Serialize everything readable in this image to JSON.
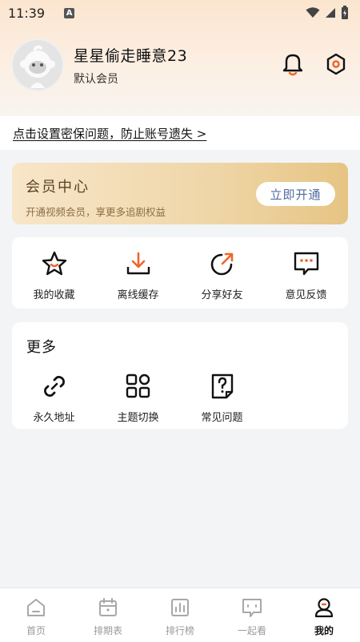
{
  "status_bar": {
    "time": "11:39",
    "indicator": "A"
  },
  "profile": {
    "username": "星星偷走睡意23",
    "member_status": "默认会员"
  },
  "security": {
    "prompt": "点击设置密保问题，防止账号遗失 >"
  },
  "vip": {
    "title": "会员中心",
    "subtitle": "开通视频会员，享更多追剧权益",
    "button": "立即开通"
  },
  "quick_actions": [
    {
      "label": "我的收藏",
      "icon": "star-icon"
    },
    {
      "label": "离线缓存",
      "icon": "download-icon"
    },
    {
      "label": "分享好友",
      "icon": "share-icon"
    },
    {
      "label": "意见反馈",
      "icon": "feedback-icon"
    }
  ],
  "more": {
    "title": "更多",
    "items": [
      {
        "label": "永久地址",
        "icon": "link-icon"
      },
      {
        "label": "主题切换",
        "icon": "theme-grid-icon"
      },
      {
        "label": "常见问题",
        "icon": "faq-icon"
      }
    ]
  },
  "tabs": [
    {
      "label": "首页",
      "icon": "home-icon"
    },
    {
      "label": "排期表",
      "icon": "calendar-icon"
    },
    {
      "label": "排行榜",
      "icon": "ranking-icon"
    },
    {
      "label": "一起看",
      "icon": "watch-together-icon"
    },
    {
      "label": "我的",
      "icon": "profile-icon",
      "active": true
    }
  ],
  "colors": {
    "accent": "#f0642a",
    "vip_text": "#5a4326",
    "vip_button_text": "#4f6aa0"
  }
}
